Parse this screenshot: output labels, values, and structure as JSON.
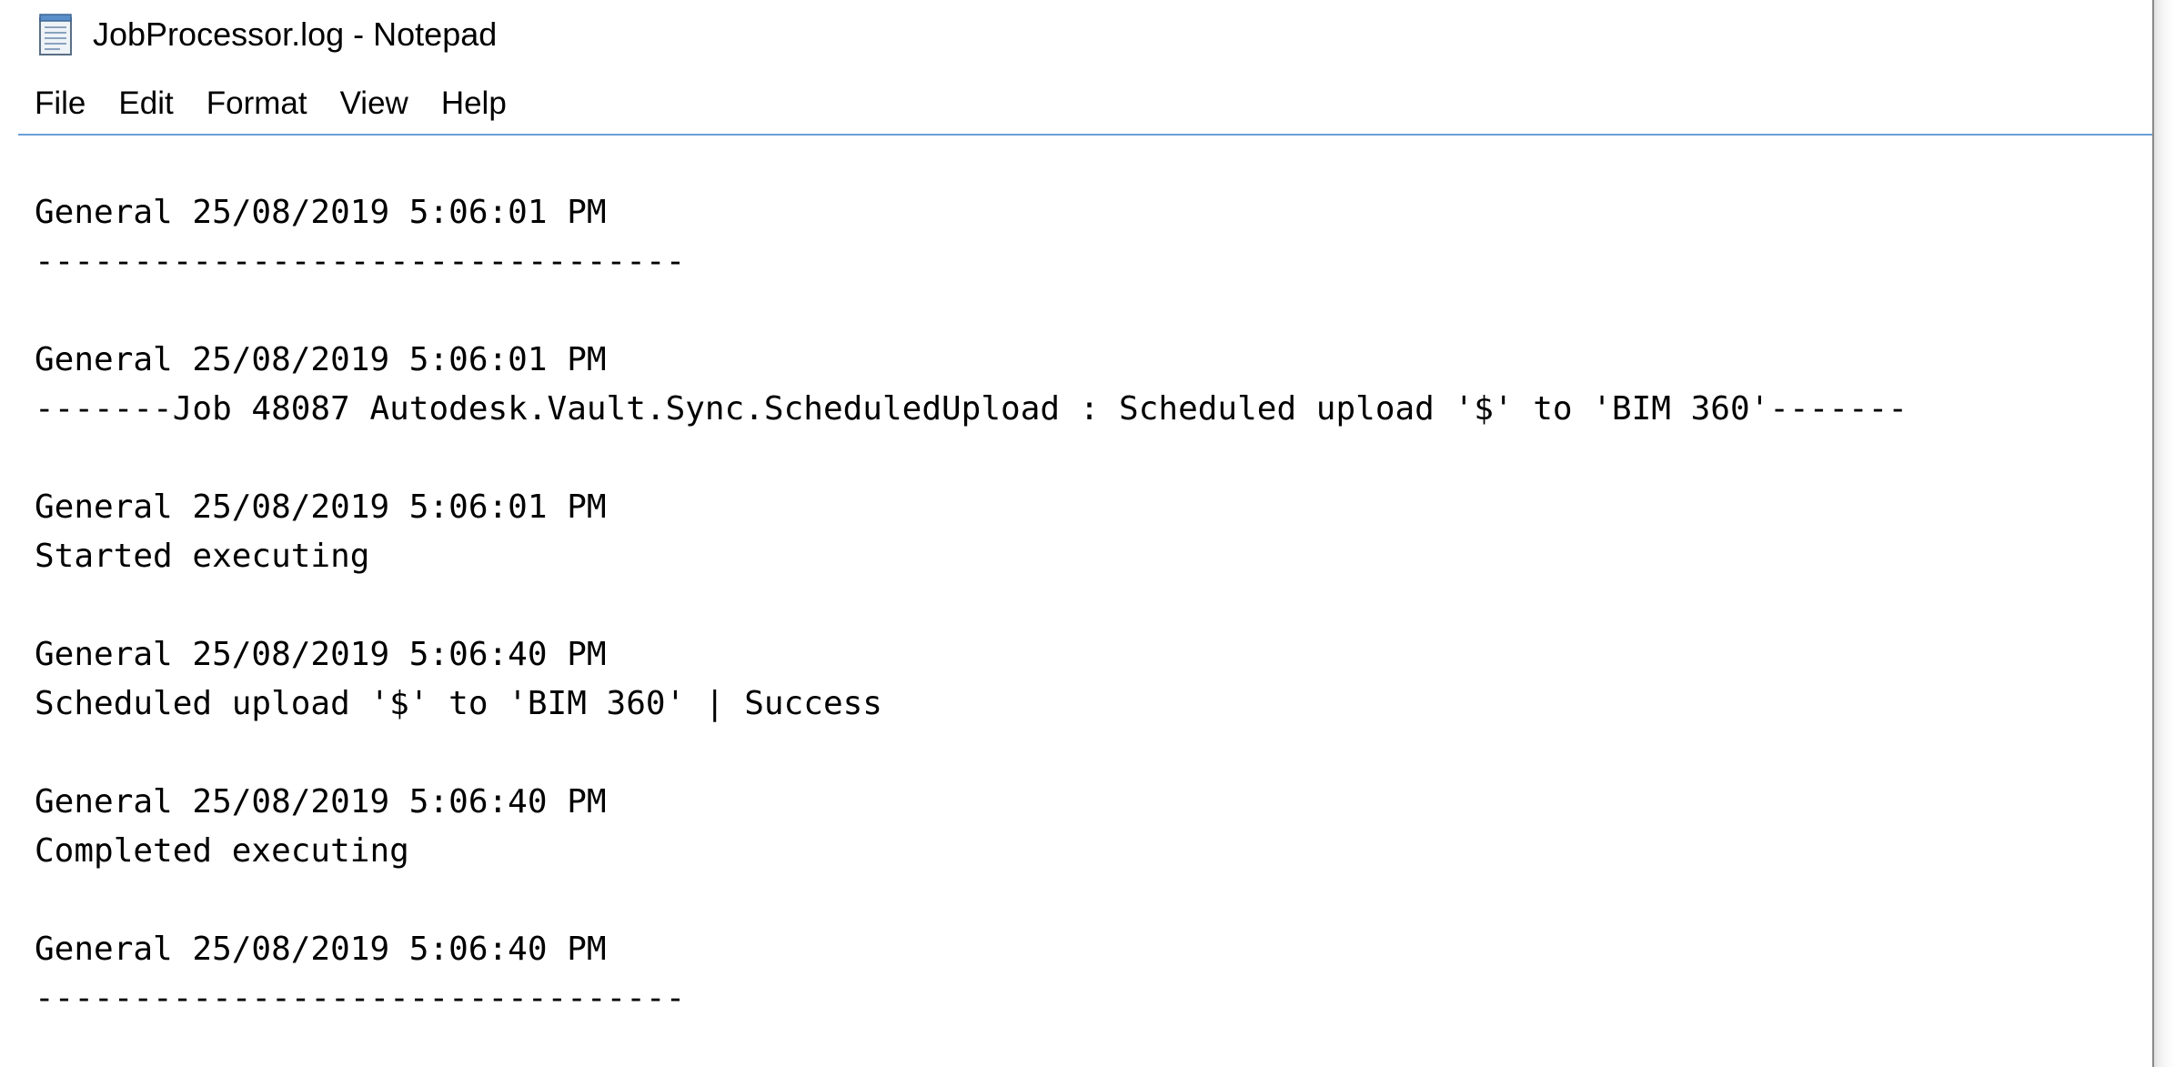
{
  "window": {
    "title": "JobProcessor.log - Notepad",
    "icon": "notepad-icon"
  },
  "menu": {
    "items": [
      {
        "label": "File"
      },
      {
        "label": "Edit"
      },
      {
        "label": "Format"
      },
      {
        "label": "View"
      },
      {
        "label": "Help"
      }
    ]
  },
  "log": {
    "entries": [
      {
        "header": "General 25/08/2019 5:06:01 PM",
        "body": "---------------------------------"
      },
      {
        "header": "General 25/08/2019 5:06:01 PM",
        "body": "-------Job 48087 Autodesk.Vault.Sync.ScheduledUpload : Scheduled upload '$' to 'BIM 360'-------"
      },
      {
        "header": "General 25/08/2019 5:06:01 PM",
        "body": "Started executing"
      },
      {
        "header": "General 25/08/2019 5:06:40 PM",
        "body": "Scheduled upload '$' to 'BIM 360' | Success"
      },
      {
        "header": "General 25/08/2019 5:06:40 PM",
        "body": "Completed executing"
      },
      {
        "header": "General 25/08/2019 5:06:40 PM",
        "body": "---------------------------------"
      }
    ]
  },
  "colors": {
    "menu_divider": "#6a9ed6",
    "text": "#000000",
    "background": "#ffffff"
  }
}
